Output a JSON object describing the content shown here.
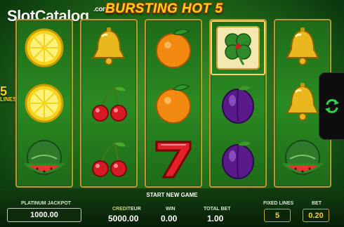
{
  "watermark": {
    "part1": "Slot",
    "part2": "Catalog",
    "suffix": ".com"
  },
  "game_title": "BURSTING HOT 5",
  "side_left": {
    "number": "5",
    "label": "LINES"
  },
  "reels": [
    [
      "lemon",
      "lemon",
      "watermelon"
    ],
    [
      "bell",
      "cherries",
      "cherries"
    ],
    [
      "orange",
      "orange",
      "seven"
    ],
    [
      "clover",
      "plum",
      "plum"
    ],
    [
      "bell",
      "bell",
      "watermelon"
    ]
  ],
  "start_text": "START NEW GAME",
  "jackpot": {
    "label": "PLATINUM JACKPOT",
    "value": "1000.00"
  },
  "credit": {
    "label": "CREDIT",
    "currency": "EUR",
    "value": "5000.00"
  },
  "win": {
    "label": "WIN",
    "value": "0.00"
  },
  "total_bet": {
    "label": "TOTAL BET",
    "value": "1.00"
  },
  "fixed_lines": {
    "label": "FIXED LINES",
    "value": "5"
  },
  "bet": {
    "label": "BET",
    "value": "0.20"
  },
  "spin_icon": "spin-arrows-icon",
  "colors": {
    "gold": "#ffd21a",
    "green": "#2b8a22"
  }
}
